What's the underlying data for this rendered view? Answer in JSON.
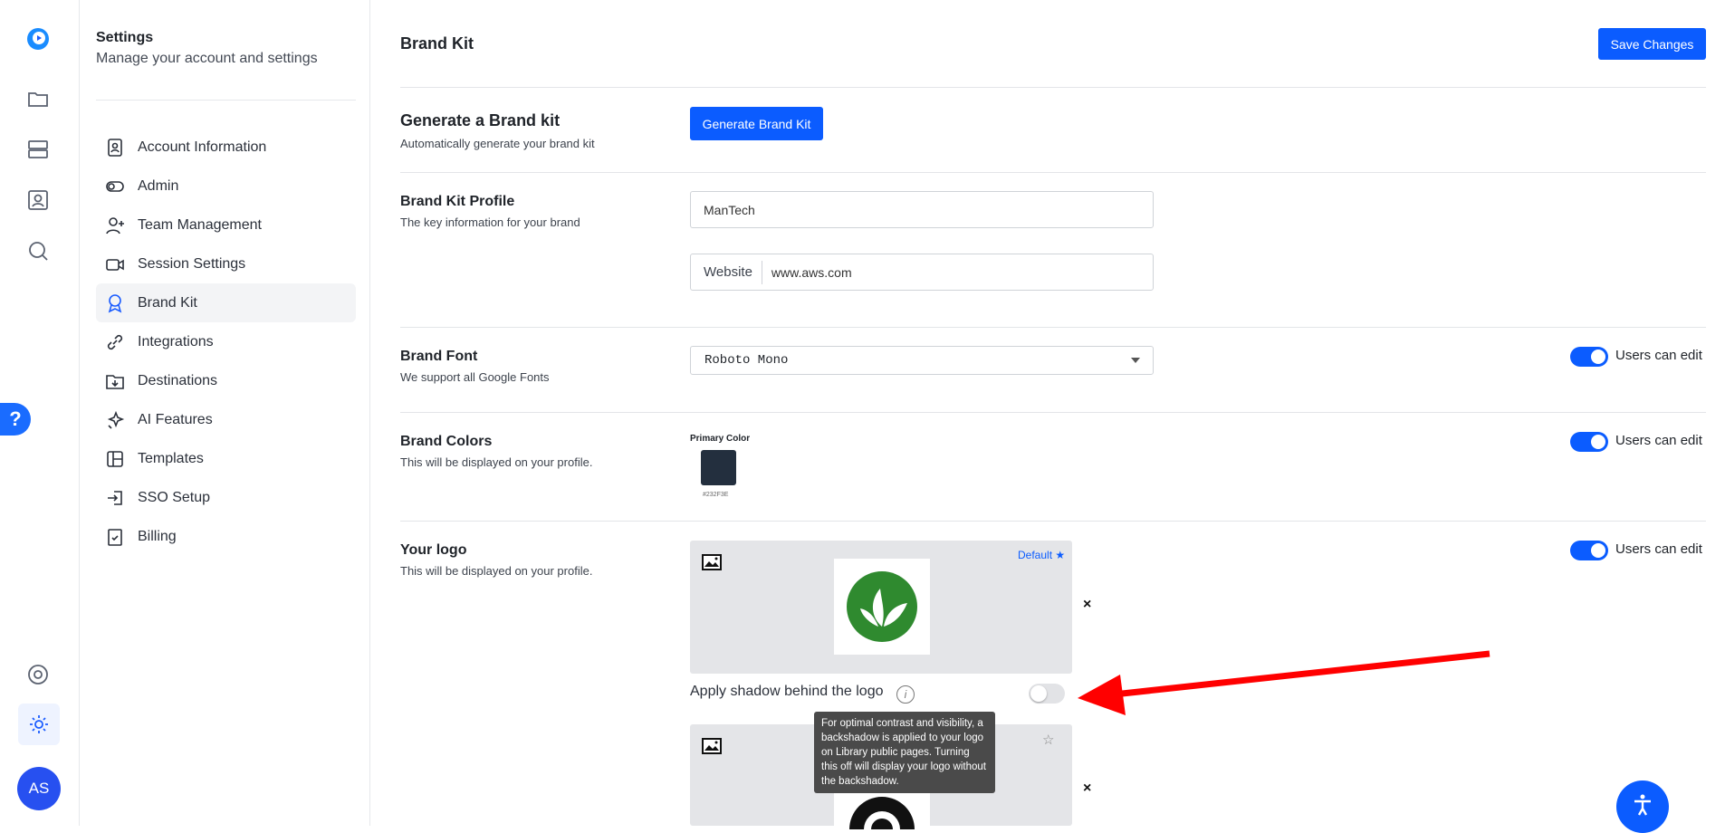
{
  "sidebar": {
    "title": "Settings",
    "subtitle": "Manage your account and settings",
    "items": [
      {
        "label": "Account Information"
      },
      {
        "label": "Admin"
      },
      {
        "label": "Team Management"
      },
      {
        "label": "Session Settings"
      },
      {
        "label": "Brand Kit"
      },
      {
        "label": "Integrations"
      },
      {
        "label": "Destinations"
      },
      {
        "label": "AI Features"
      },
      {
        "label": "Templates"
      },
      {
        "label": "SSO Setup"
      },
      {
        "label": "Billing"
      }
    ]
  },
  "rail": {
    "avatar_initials": "AS",
    "help_label": "?"
  },
  "header": {
    "title": "Brand Kit",
    "save_label": "Save Changes"
  },
  "generate": {
    "title": "Generate a Brand kit",
    "desc": "Automatically generate your brand kit",
    "button": "Generate Brand Kit"
  },
  "profile": {
    "title": "Brand Kit Profile",
    "desc": "The key information for your brand",
    "name_value": "ManTech",
    "website_prefix": "Website",
    "website_value": "www.aws.com"
  },
  "font": {
    "title": "Brand Font",
    "desc": "We support all Google Fonts",
    "value": "Roboto Mono",
    "users_edit": "Users can edit"
  },
  "colors": {
    "title": "Brand Colors",
    "desc": "This will be displayed on your profile.",
    "primary_label": "Primary Color",
    "primary_hex": "#232F3E",
    "users_edit": "Users can edit"
  },
  "logo": {
    "title": "Your logo",
    "desc": "This will be displayed on your profile.",
    "default_label": "Default ★",
    "users_edit": "Users can edit",
    "shadow_label": "Apply shadow behind the logo",
    "tooltip": "For optimal contrast and visibility, a backshadow is applied to your logo on Library public pages. Turning this off will display your logo without the backshadow.",
    "close": "×",
    "star": "☆"
  },
  "colors_theme": {
    "accent": "#0b5cff",
    "annotation": "#ff0000"
  }
}
